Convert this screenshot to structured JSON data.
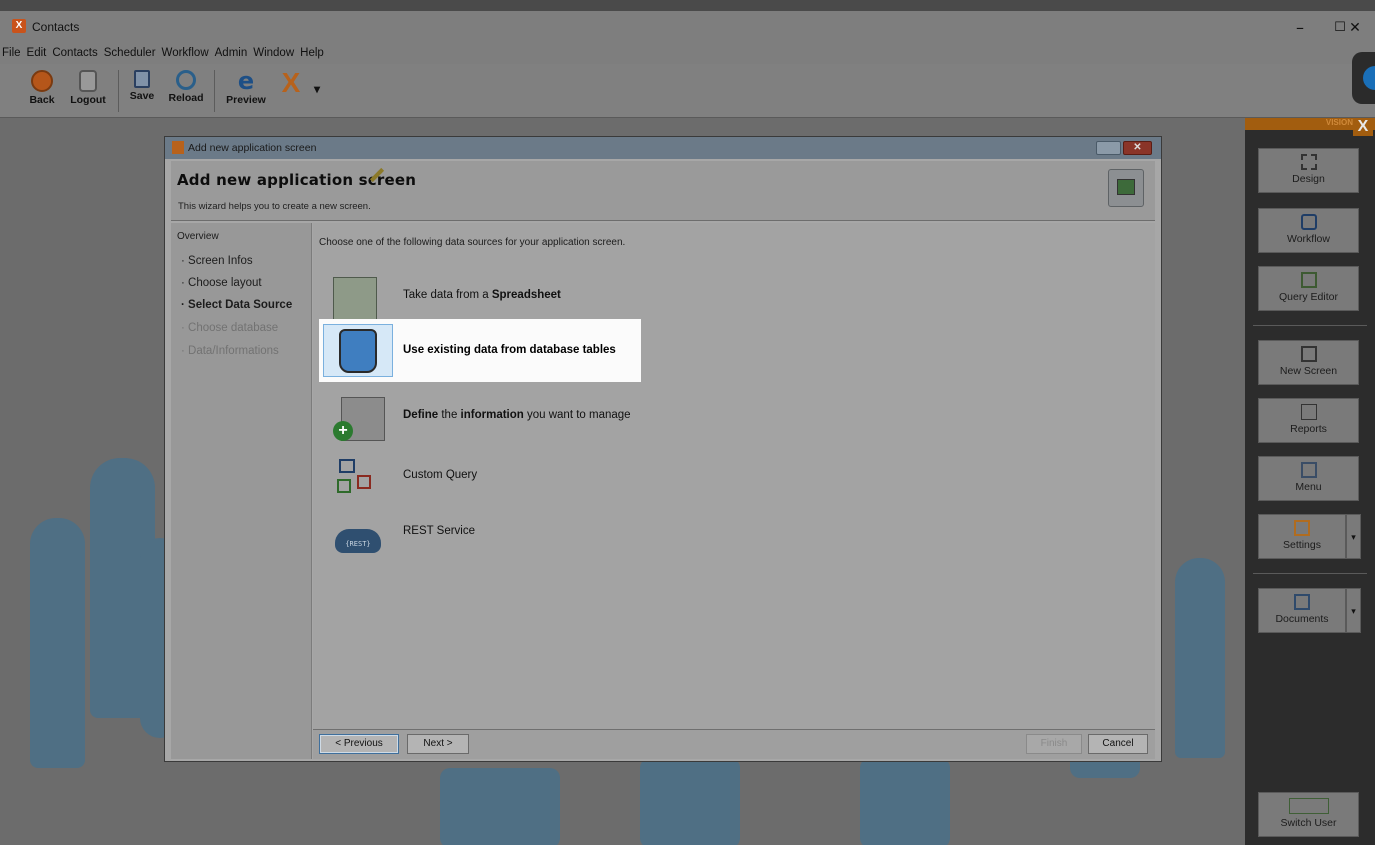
{
  "window": {
    "title": "Contacts",
    "minimize": "–",
    "maximize": "☐",
    "close": "✕"
  },
  "menu": [
    "File",
    "Edit",
    "Contacts",
    "Scheduler",
    "Workflow",
    "Admin",
    "Window",
    "Help"
  ],
  "toolbar": {
    "back": "Back",
    "logout": "Logout",
    "save": "Save",
    "reload": "Reload",
    "preview": "Preview",
    "dropdown": "▾"
  },
  "side_panel": {
    "header": "VISION",
    "logo": "X",
    "buttons": {
      "design": "Design",
      "workflow": "Workflow",
      "query_editor": "Query Editor",
      "new_screen": "New Screen",
      "reports": "Reports",
      "menu": "Menu",
      "settings": "Settings",
      "documents": "Documents",
      "switch_user": "Switch User"
    },
    "dropdown_arrow": "▾"
  },
  "dialog": {
    "window_title": "Add new application screen",
    "heading": "Add new application screen",
    "subtitle": "This wizard helps you to create a new screen.",
    "close": "✕",
    "overview_label": "Overview",
    "steps": [
      {
        "label": "Screen Infos",
        "state": "done"
      },
      {
        "label": "Choose layout",
        "state": "done"
      },
      {
        "label": "Select Data Source",
        "state": "current"
      },
      {
        "label": "Choose database",
        "state": "disabled"
      },
      {
        "label": "Data/Informations",
        "state": "disabled"
      }
    ],
    "intro": "Choose one of the following data sources for your application screen.",
    "options": {
      "spreadsheet": {
        "pre": "Take data from a ",
        "bold": "Spreadsheet"
      },
      "database": {
        "label": "Use existing data from database tables"
      },
      "define": {
        "bold1": "Define",
        "mid": " the ",
        "bold2": "information",
        "post": " you want to manage"
      },
      "custom_query": {
        "label": "Custom Query"
      },
      "rest": {
        "label": "REST Service",
        "badge": "{REST}"
      }
    },
    "footer": {
      "previous": "< Previous",
      "next": "Next >",
      "finish": "Finish",
      "cancel": "Cancel"
    }
  }
}
